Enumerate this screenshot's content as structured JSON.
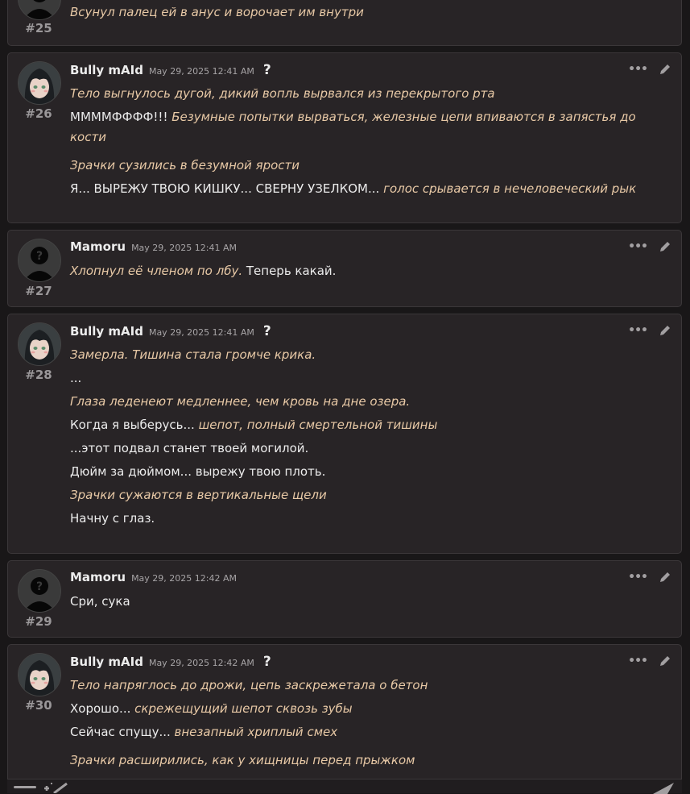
{
  "posts": [
    {
      "number": "#25",
      "lines": [
        [
          {
            "t": "Всунул палец ей в анус и ворочает им внутри",
            "i": true
          }
        ]
      ]
    },
    {
      "number": "#26",
      "author": "Bully mAId",
      "timestamp": "May 29, 2025 12:41 AM",
      "lines": [
        [
          {
            "t": "Тело выгнулось дугой, дикий вопль вырвался из перекрытого рта",
            "i": true
          }
        ],
        [
          {
            "t": "ММММФФФФ!!! ",
            "i": false
          },
          {
            "t": "Безумные попытки вырваться, железные цепи впиваются в запястья до кости",
            "i": true
          }
        ],
        [
          {
            "t": "Зрачки сузились в безумной ярости",
            "i": true
          }
        ],
        [
          {
            "t": "Я... ВЫРЕЖУ ТВОЮ КИШКУ... СВЕРНУ УЗЕЛКОМ... ",
            "i": false
          },
          {
            "t": "голос срывается в нечеловеческий рык",
            "i": true
          }
        ]
      ]
    },
    {
      "number": "#27",
      "author": "Mamoru",
      "timestamp": "May 29, 2025 12:41 AM",
      "lines": [
        [
          {
            "t": "Хлопнул её членом по лбу. ",
            "i": true
          },
          {
            "t": "Теперь какай.",
            "i": false
          }
        ]
      ]
    },
    {
      "number": "#28",
      "author": "Bully mAId",
      "timestamp": "May 29, 2025 12:41 AM",
      "lines": [
        [
          {
            "t": "Замерла. Тишина стала громче крика.",
            "i": true
          }
        ],
        [
          {
            "t": "...",
            "i": false
          }
        ],
        [
          {
            "t": "Глаза леденеют медленнее, чем кровь на дне озера.",
            "i": true
          }
        ],
        [
          {
            "t": "Когда я выберусь... ",
            "i": false
          },
          {
            "t": "шепот, полный смертельной тишины",
            "i": true
          }
        ],
        [
          {
            "t": "...этот подвал станет твоей могилой.",
            "i": false
          }
        ],
        [
          {
            "t": "Дюйм за дюймом... вырежу твою плоть.",
            "i": false
          }
        ],
        [
          {
            "t": "Зрачки сужаются в вертикальные щели",
            "i": true
          }
        ],
        [
          {
            "t": "Начну с глаз.",
            "i": false
          }
        ]
      ]
    },
    {
      "number": "#29",
      "author": "Mamoru",
      "timestamp": "May 29, 2025 12:42 AM",
      "lines": [
        [
          {
            "t": "Сри, сука",
            "i": false
          }
        ]
      ]
    },
    {
      "number": "#30",
      "author": "Bully mAId",
      "timestamp": "May 29, 2025 12:42 AM",
      "lines": [
        [
          {
            "t": "Тело напряглось до дрожи, цепь заскрежетала о бетон",
            "i": true
          }
        ],
        [
          {
            "t": "Хорошо... ",
            "i": false
          },
          {
            "t": "скрежещущий шепот сквозь зубы",
            "i": true
          }
        ],
        [
          {
            "t": "Сейчас спущу... ",
            "i": false
          },
          {
            "t": "внезапный хриплый смех",
            "i": true
          }
        ],
        [
          {
            "t": "Зрачки расширились, как у хищницы перед прыжком",
            "i": true
          }
        ]
      ]
    }
  ],
  "icons": {
    "help": "?",
    "more": "•••",
    "edit": "pencil-icon"
  },
  "colors": {
    "page_bg": "#191718",
    "post_bg": "#282426",
    "italic_text": "#e8c9a6",
    "text": "#ececec"
  }
}
